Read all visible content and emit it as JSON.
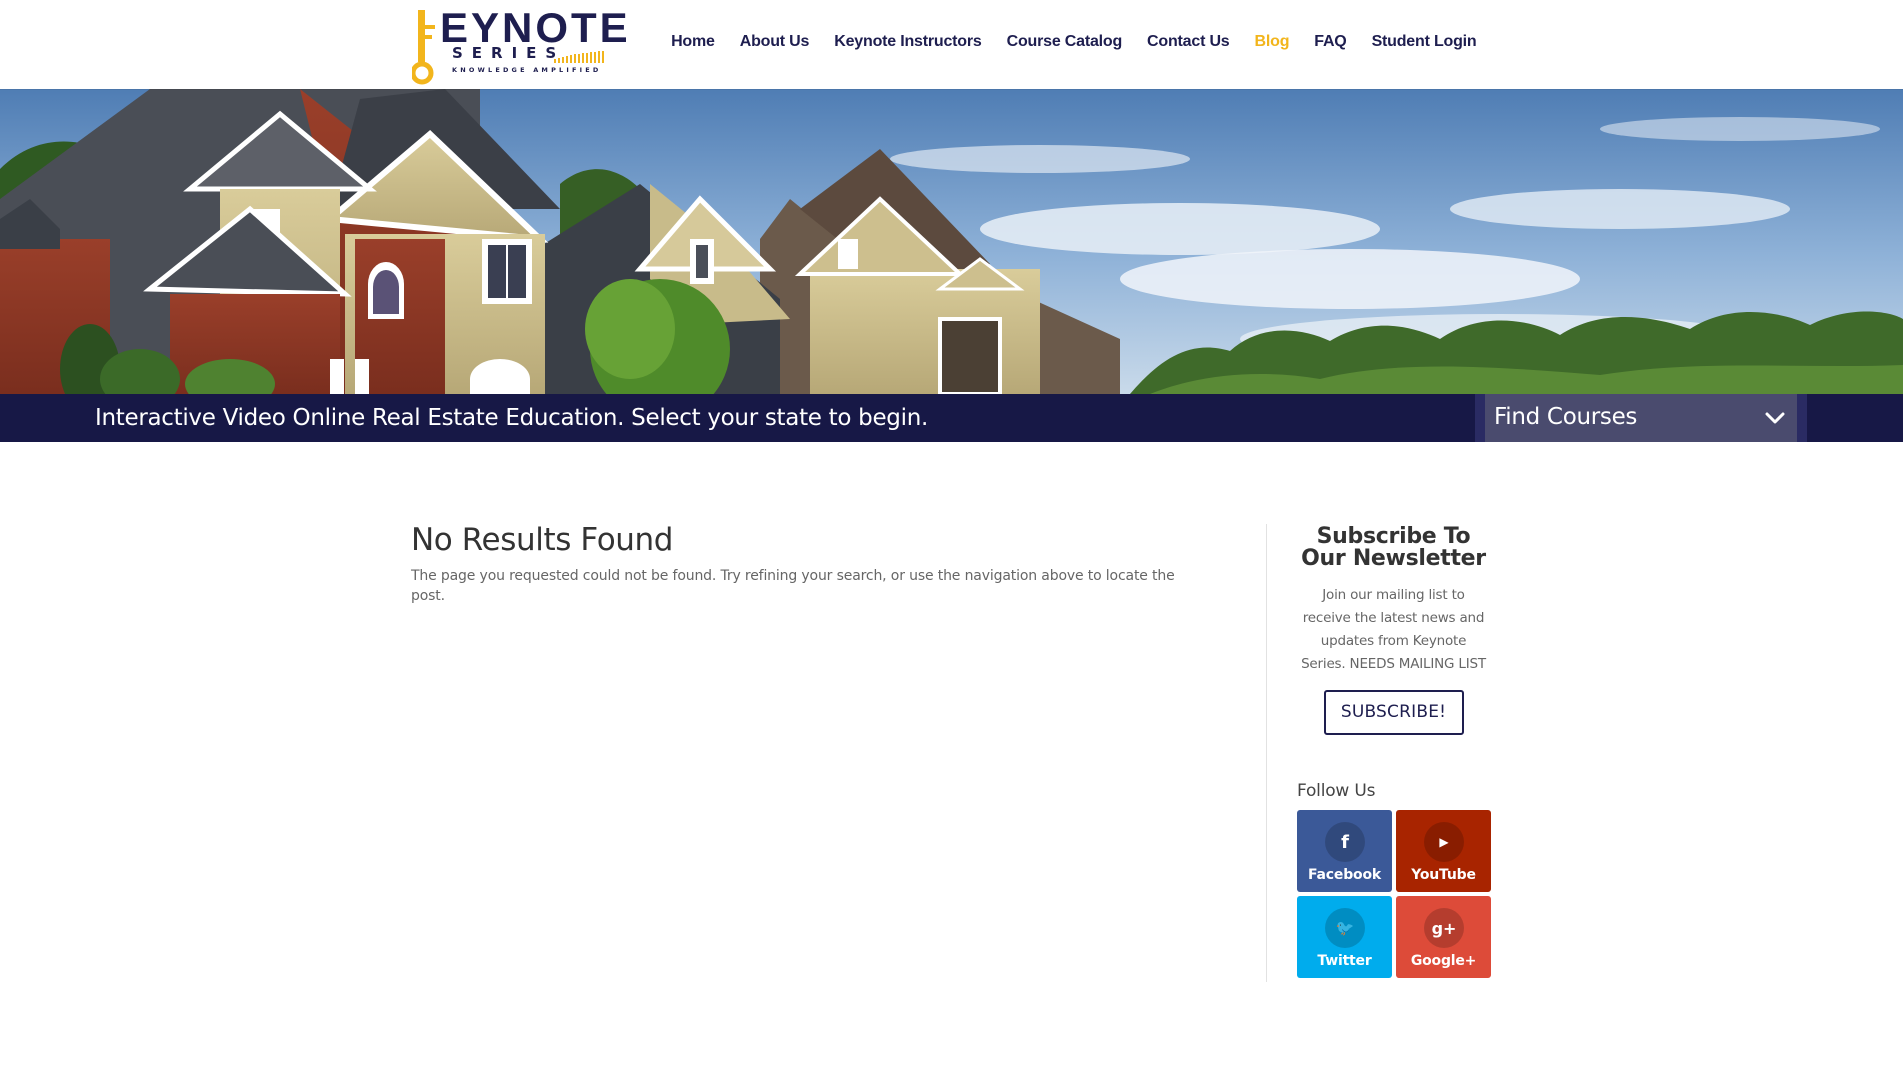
{
  "header": {
    "logo": {
      "brand_word": "EYNOTE",
      "brand_series": "SERIES",
      "tagline": "KNOWLEDGE AMPLIFIED",
      "alt": "Keynote Series"
    },
    "nav": [
      {
        "label": "Home",
        "active": false
      },
      {
        "label": "About Us",
        "active": false
      },
      {
        "label": "Keynote Instructors",
        "active": false
      },
      {
        "label": "Course Catalog",
        "active": false
      },
      {
        "label": "Contact Us",
        "active": false
      },
      {
        "label": "Blog",
        "active": true
      },
      {
        "label": "FAQ",
        "active": false
      },
      {
        "label": "Student Login",
        "active": false
      }
    ]
  },
  "banner": {
    "text": "Interactive Video Online Real Estate Education. Select your state to begin.",
    "select_label": "Find Courses"
  },
  "main": {
    "title": "No Results Found",
    "message": "The page you requested could not be found. Try refining your search, or use the navigation above to locate the post."
  },
  "sidebar": {
    "newsletter_title": "Subscribe To Our Newsletter",
    "newsletter_text": "Join our mailing list to receive the latest news and updates from Keynote Series. NEEDS MAILING LIST",
    "subscribe_label": "SUBSCRIBE!",
    "follow_title": "Follow Us",
    "social": [
      {
        "label": "Facebook",
        "glyph": "f",
        "icon": "facebook-icon",
        "color": "#3b5998"
      },
      {
        "label": "YouTube",
        "glyph": "▶",
        "icon": "youtube-icon",
        "color": "#a82400"
      },
      {
        "label": "Twitter",
        "glyph": "🐦",
        "icon": "twitter-icon",
        "color": "#00aced"
      },
      {
        "label": "Google+",
        "glyph": "g+",
        "icon": "google-plus-icon",
        "color": "#dd4b39"
      }
    ]
  },
  "colors": {
    "brand_navy": "#1e1e4f",
    "brand_gold": "#f2b51c",
    "banner_bg": "#171846"
  }
}
